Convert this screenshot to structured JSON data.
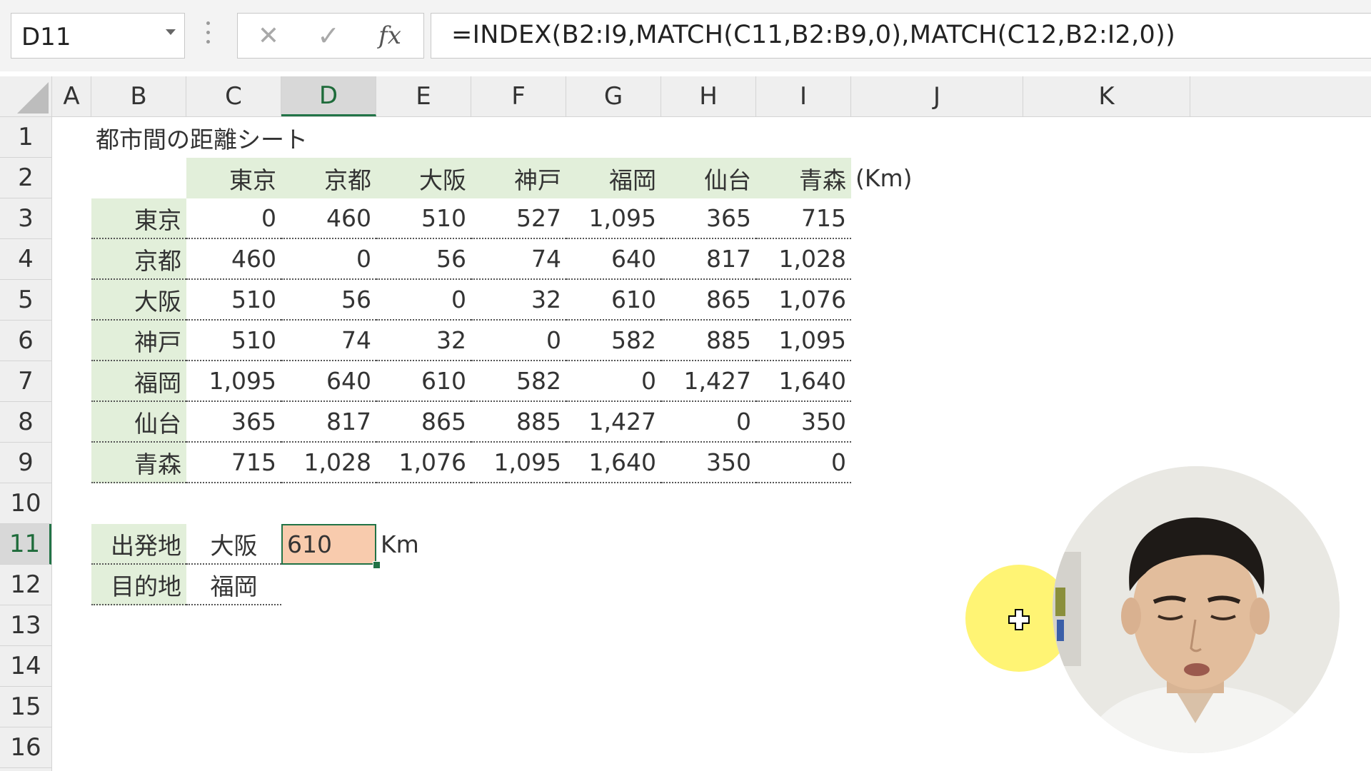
{
  "name_box": {
    "value": "D11"
  },
  "formula_bar": {
    "cancel_symbol": "✕",
    "enter_symbol": "✓",
    "fx_symbol": "fx",
    "formula": "=INDEX(B2:I9,MATCH(C11,B2:B9,0),MATCH(C12,B2:I2,0))"
  },
  "columns": [
    "A",
    "B",
    "C",
    "D",
    "E",
    "F",
    "G",
    "H",
    "I",
    "J",
    "K"
  ],
  "selected_column": "D",
  "rows": [
    "1",
    "2",
    "3",
    "4",
    "5",
    "6",
    "7",
    "8",
    "9",
    "10",
    "11",
    "12",
    "13",
    "14",
    "15",
    "16"
  ],
  "selected_row": "11",
  "sheet": {
    "title": "都市間の距離シート",
    "unit_label": "(Km)",
    "cities": [
      "東京",
      "京都",
      "大阪",
      "神戸",
      "福岡",
      "仙台",
      "青森"
    ],
    "distances": [
      [
        "0",
        "460",
        "510",
        "527",
        "1,095",
        "365",
        "715"
      ],
      [
        "460",
        "0",
        "56",
        "74",
        "640",
        "817",
        "1,028"
      ],
      [
        "510",
        "56",
        "0",
        "32",
        "610",
        "865",
        "1,076"
      ],
      [
        "510",
        "74",
        "32",
        "0",
        "582",
        "885",
        "1,095"
      ],
      [
        "1,095",
        "640",
        "610",
        "582",
        "0",
        "1,427",
        "1,640"
      ],
      [
        "365",
        "817",
        "865",
        "885",
        "1,427",
        "0",
        "350"
      ],
      [
        "715",
        "1,028",
        "1,076",
        "1,095",
        "1,640",
        "350",
        "0"
      ]
    ],
    "lookup": {
      "origin_label": "出発地",
      "origin_value": "大阪",
      "destination_label": "目的地",
      "destination_value": "福岡",
      "result": "610",
      "result_unit": "Km"
    }
  },
  "colors": {
    "accent_green": "#217346",
    "header_fill": "#e2efda",
    "active_cell_fill": "#f8cbad",
    "cursor_highlight": "#fff046"
  },
  "icons": {
    "name_box_dropdown": "chevron-down-icon",
    "cursor": "crosshair-cursor-icon"
  }
}
